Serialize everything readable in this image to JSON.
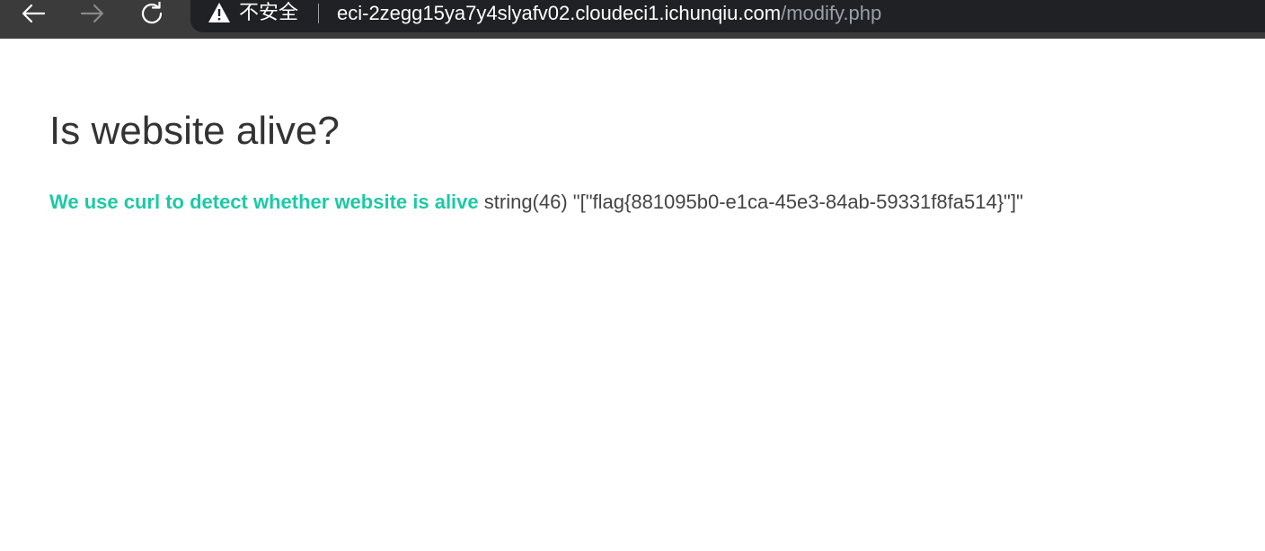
{
  "browser": {
    "security_label": "不安全",
    "url_host": "eci-2zegg15ya7y4slyafv02.cloudeci1.ichunqiu.com",
    "url_path": "/modify.php",
    "icons": {
      "back": "back-arrow-icon",
      "forward": "forward-arrow-icon",
      "reload": "reload-icon",
      "warning": "warning-triangle-icon"
    }
  },
  "page": {
    "heading": "Is website alive?",
    "lead_text": "We use curl to detect whether website is alive",
    "output_text": " string(46) \"[\"flag{881095b0-e1ca-45e3-84ab-59331f8fa514}\"]\""
  },
  "colors": {
    "accent": "#1dc9a4",
    "heading_text": "#333333",
    "toolbar": "#3b3b3b",
    "address_bar": "#202124"
  }
}
